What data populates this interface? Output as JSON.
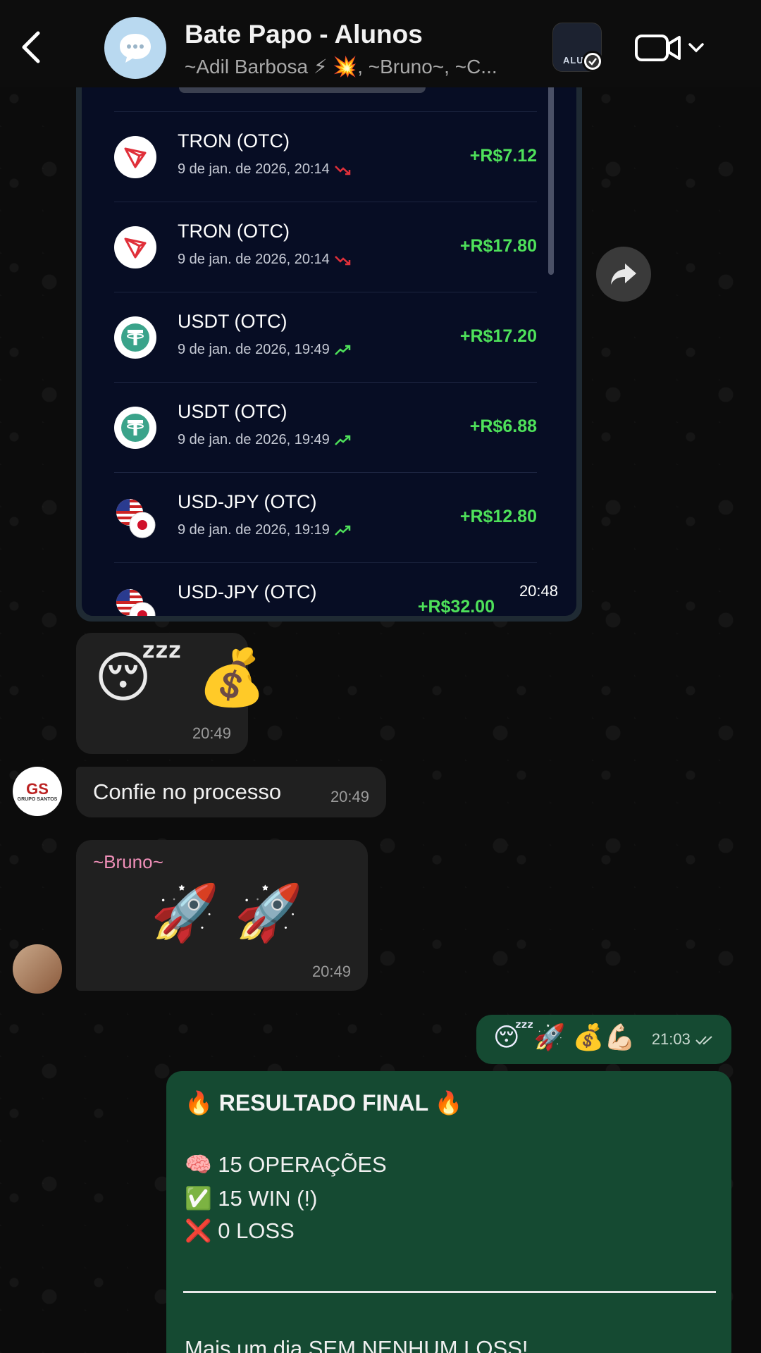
{
  "header": {
    "title": "Bate Papo - Alunos",
    "subtitle": "~Adil Barbosa ⚡ 💥, ~Bruno~, ~C...",
    "community_label": "ALUN"
  },
  "image_message": {
    "time": "20:48",
    "trades": [
      {
        "name": "TRON (OTC)",
        "date": "9 de jan. de 2026, 20:14",
        "trend": "down",
        "amount": "+R$7.12",
        "coin": "tron"
      },
      {
        "name": "TRON (OTC)",
        "date": "9 de jan. de 2026, 20:14",
        "trend": "down",
        "amount": "+R$17.80",
        "coin": "tron"
      },
      {
        "name": "USDT (OTC)",
        "date": "9 de jan. de 2026, 19:49",
        "trend": "up",
        "amount": "+R$17.20",
        "coin": "usdt"
      },
      {
        "name": "USDT (OTC)",
        "date": "9 de jan. de 2026, 19:49",
        "trend": "up",
        "amount": "+R$6.88",
        "coin": "usdt"
      },
      {
        "name": "USD-JPY (OTC)",
        "date": "9 de jan. de 2026, 19:19",
        "trend": "up",
        "amount": "+R$12.80",
        "coin": "usdjpy"
      },
      {
        "name": "USD-JPY (OTC)",
        "date": "",
        "trend": "up",
        "amount": "+R$32.00",
        "coin": "usdjpy"
      }
    ]
  },
  "messages": {
    "emoji_msg": {
      "emojis": "😴 💰",
      "time": "20:49"
    },
    "text_msg": {
      "text": "Confie no processo",
      "time": "20:49",
      "avatar_text": "GS",
      "avatar_sub": "GRUPO SANTOS"
    },
    "bruno_msg": {
      "sender": "~Bruno~",
      "emojis": "🚀 🚀",
      "time": "20:49"
    },
    "out_emoji": {
      "emojis": "😴🚀 💰💪🏻",
      "time": "21:03"
    },
    "result": {
      "title": "🔥 RESULTADO FINAL 🔥",
      "line1": "🧠 15 OPERAÇÕES",
      "line2": "✅ 15 WIN (!)",
      "line3": "❌ 0 LOSS",
      "cut_text": "Mais um dia SEM NENHUM LOSS!"
    }
  },
  "colors": {
    "accent_green": "#4ee15a",
    "outgoing_bubble": "#154a32",
    "incoming_bubble": "#202020",
    "sender_name": "#ef8fb8"
  },
  "icons": [
    "back-chevron-icon",
    "chat-bubble-icon",
    "verified-check-icon",
    "video-camera-icon",
    "chevron-down-icon",
    "forward-icon",
    "tron-icon",
    "tether-icon",
    "usd-jpy-flag-icon",
    "trend-up-icon",
    "trend-down-icon",
    "double-check-icon"
  ]
}
